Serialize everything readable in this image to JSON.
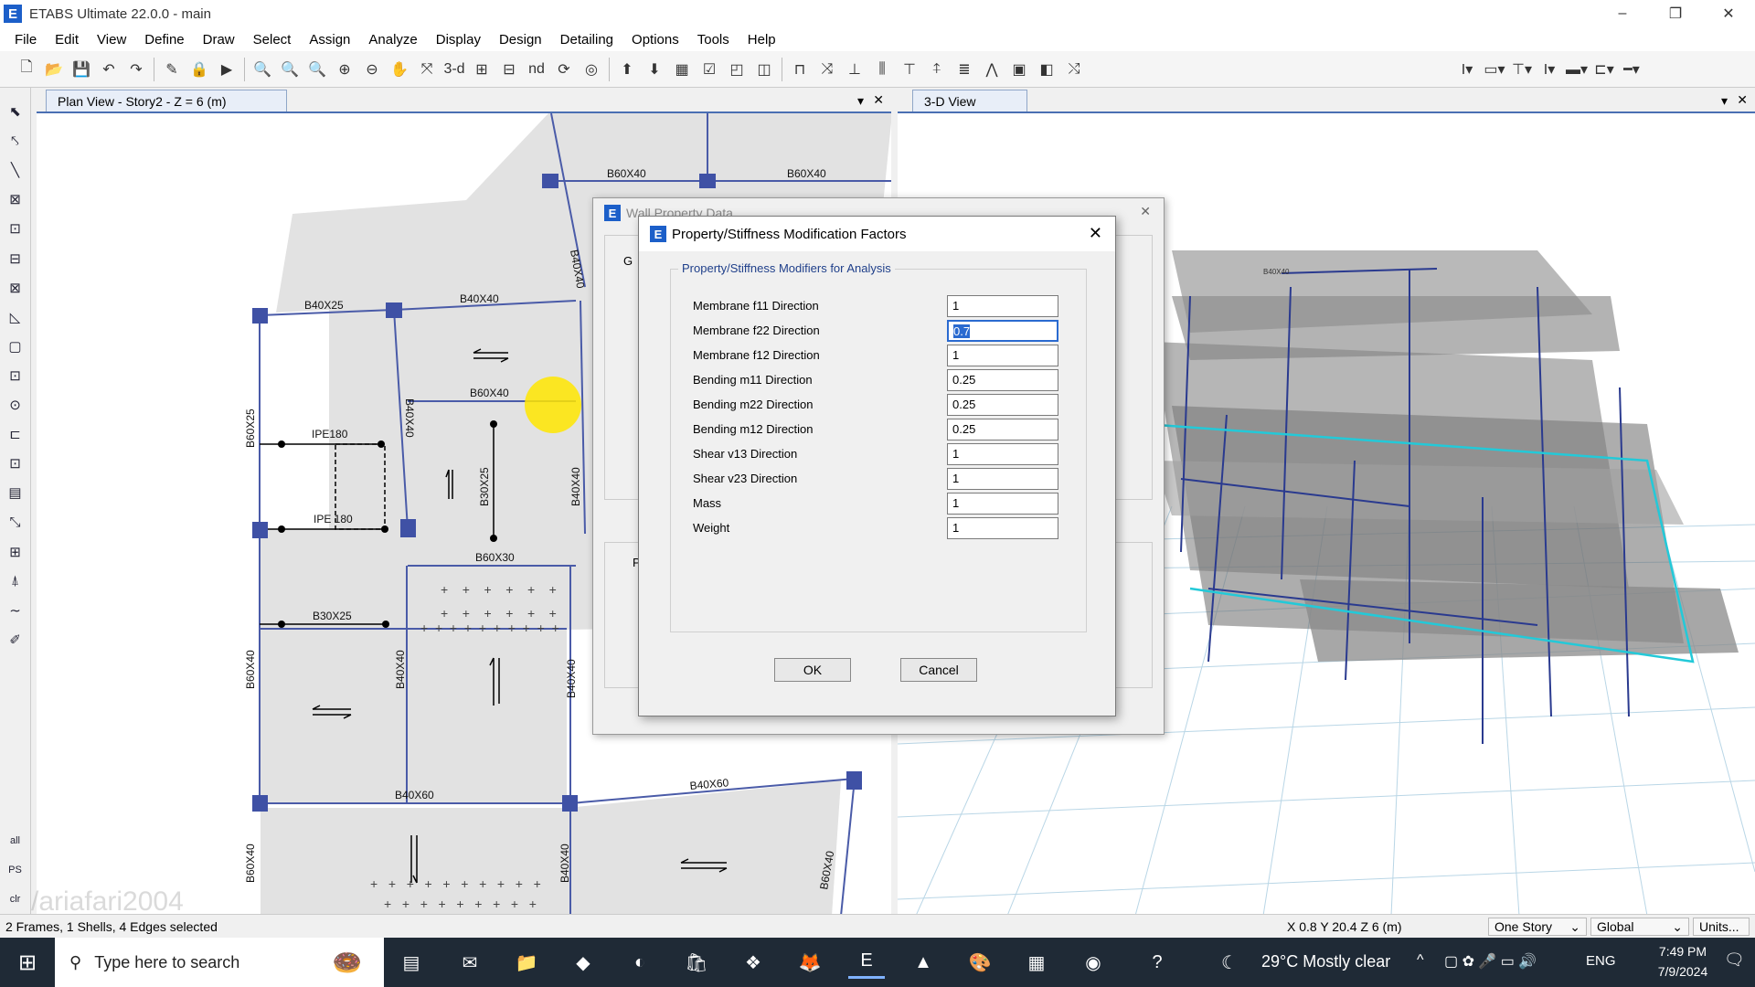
{
  "window": {
    "title": "ETABS Ultimate 22.0.0 - main",
    "logo": "E",
    "min": "–",
    "restore": "❐",
    "close": "✕"
  },
  "menu": [
    "File",
    "Edit",
    "View",
    "Define",
    "Draw",
    "Select",
    "Assign",
    "Analyze",
    "Display",
    "Design",
    "Detailing",
    "Options",
    "Tools",
    "Help"
  ],
  "toolbar": {
    "label_3d": "3-d",
    "label_nd": "nd"
  },
  "plan_tab": {
    "label": "Plan View - Story2 - Z = 6 (m)",
    "dropdown": "▾",
    "close": "✕"
  },
  "view3d_tab": {
    "label": "3-D View",
    "dropdown": "▾",
    "close": "✕"
  },
  "plan_labels": {
    "b60x40_a": "B60X40",
    "b60x40_b": "B60X40",
    "b40x25": "B40X25",
    "b40x40_top": "B40X40",
    "b60x25": "B60X25",
    "b60x40_mid": "B60X40",
    "b40x40_vert": "B40X40",
    "ipe180_a": "IPE180",
    "ipe180_b": "IPE 180",
    "b30x25_vert": "B30X25",
    "b60x30": "B60X30",
    "b30x25": "B30X25",
    "b60x40_left": "B60X40",
    "b40x40_l2": "B40X40",
    "b40x40_r2": "B40X40",
    "b40x60": "B40X60",
    "b40x60_r": "B40X60",
    "b60x40_bl": "B60X40",
    "b40x40_bm": "B40X40",
    "b60x40_br": "B60X40",
    "b40x40_side": "B40X40",
    "b40x40_side2": "B40X40"
  },
  "view3d_label": "B40X40",
  "wall_dialog": {
    "title": "Wall Property Data",
    "close": "✕",
    "g": "G",
    "p": "P"
  },
  "modifiers_dialog": {
    "title": "Property/Stiffness Modification Factors",
    "close": "✕",
    "group_title": "Property/Stiffness Modifiers for Analysis",
    "rows": [
      {
        "label": "Membrane f11 Direction",
        "value": "1"
      },
      {
        "label": "Membrane f22 Direction",
        "value": "0.7"
      },
      {
        "label": "Membrane f12 Direction",
        "value": "1"
      },
      {
        "label": "Bending m11 Direction",
        "value": "0.25"
      },
      {
        "label": "Bending m22 Direction",
        "value": "0.25"
      },
      {
        "label": "Bending m12 Direction",
        "value": "0.25"
      },
      {
        "label": "Shear v13 Direction",
        "value": "1"
      },
      {
        "label": "Shear v23 Direction",
        "value": "1"
      },
      {
        "label": "Mass",
        "value": "1"
      },
      {
        "label": "Weight",
        "value": "1"
      }
    ],
    "ok": "OK",
    "cancel": "Cancel"
  },
  "statusbar": {
    "selection": "2 Frames, 1 Shells, 4 Edges selected",
    "watermark": "/ariafari2004",
    "coords": "X 0.8  Y 20.4  Z 6 (m)",
    "story": "One Story",
    "coord_sys": "Global",
    "units": "Units..."
  },
  "left_tools_text": {
    "all": "all",
    "ps": "PS",
    "clr": "clr"
  },
  "taskbar": {
    "search_placeholder": "Type here to search",
    "weather": "29°C  Mostly clear",
    "lang": "ENG",
    "time": "7:49 PM",
    "date": "7/9/2024"
  },
  "colors": {
    "accent": "#2a6ad0",
    "beam_line": "#4a5ba8",
    "column": "#3f51a5",
    "slab": "#e2e2e2",
    "highlight": "#ffe600",
    "taskbar": "#1f2a36"
  }
}
